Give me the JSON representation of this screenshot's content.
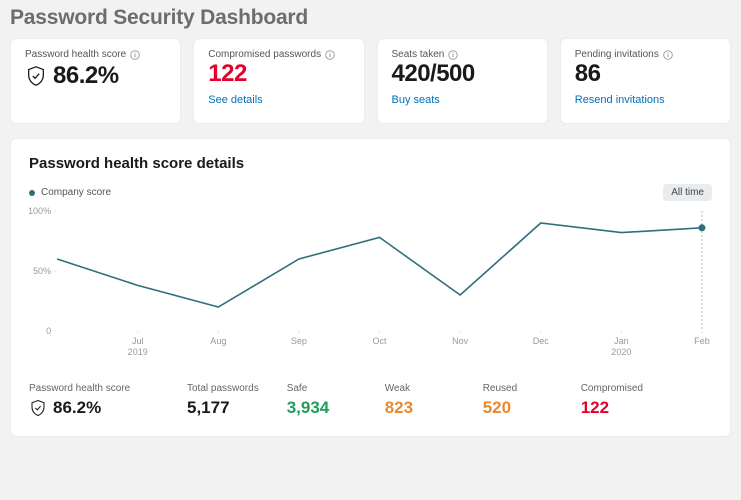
{
  "page_title": "Password Security Dashboard",
  "cards": {
    "health": {
      "label": "Password health score",
      "value": "86.2%"
    },
    "compromised": {
      "label": "Compromised passwords",
      "value": "122",
      "link": "See details"
    },
    "seats": {
      "label": "Seats taken",
      "value": "420/500",
      "link": "Buy seats"
    },
    "pending": {
      "label": "Pending invitations",
      "value": "86",
      "link": "Resend invitations"
    }
  },
  "panel": {
    "title": "Password health score details",
    "legend": "Company score",
    "range_label": "All time"
  },
  "chart_data": {
    "type": "line",
    "xlabel": "",
    "ylabel": "",
    "ylim": [
      0,
      100
    ],
    "y_ticks": [
      "0",
      "50%",
      "100%"
    ],
    "x_categories": [
      "Jul",
      "Aug",
      "Sep",
      "Oct",
      "Nov",
      "Dec",
      "Jan",
      "Feb"
    ],
    "x_sub": {
      "Jul": "2019",
      "Jan": "2020"
    },
    "series": [
      {
        "name": "Company score",
        "values": [
          60,
          38,
          20,
          60,
          78,
          30,
          90,
          82,
          86
        ]
      }
    ],
    "marker_index": 8
  },
  "stats": {
    "health": {
      "label": "Password health score",
      "value": "86.2%"
    },
    "total": {
      "label": "Total passwords",
      "value": "5,177"
    },
    "safe": {
      "label": "Safe",
      "value": "3,934"
    },
    "weak": {
      "label": "Weak",
      "value": "823"
    },
    "reused": {
      "label": "Reused",
      "value": "520"
    },
    "compromised": {
      "label": "Compromised",
      "value": "122"
    }
  }
}
